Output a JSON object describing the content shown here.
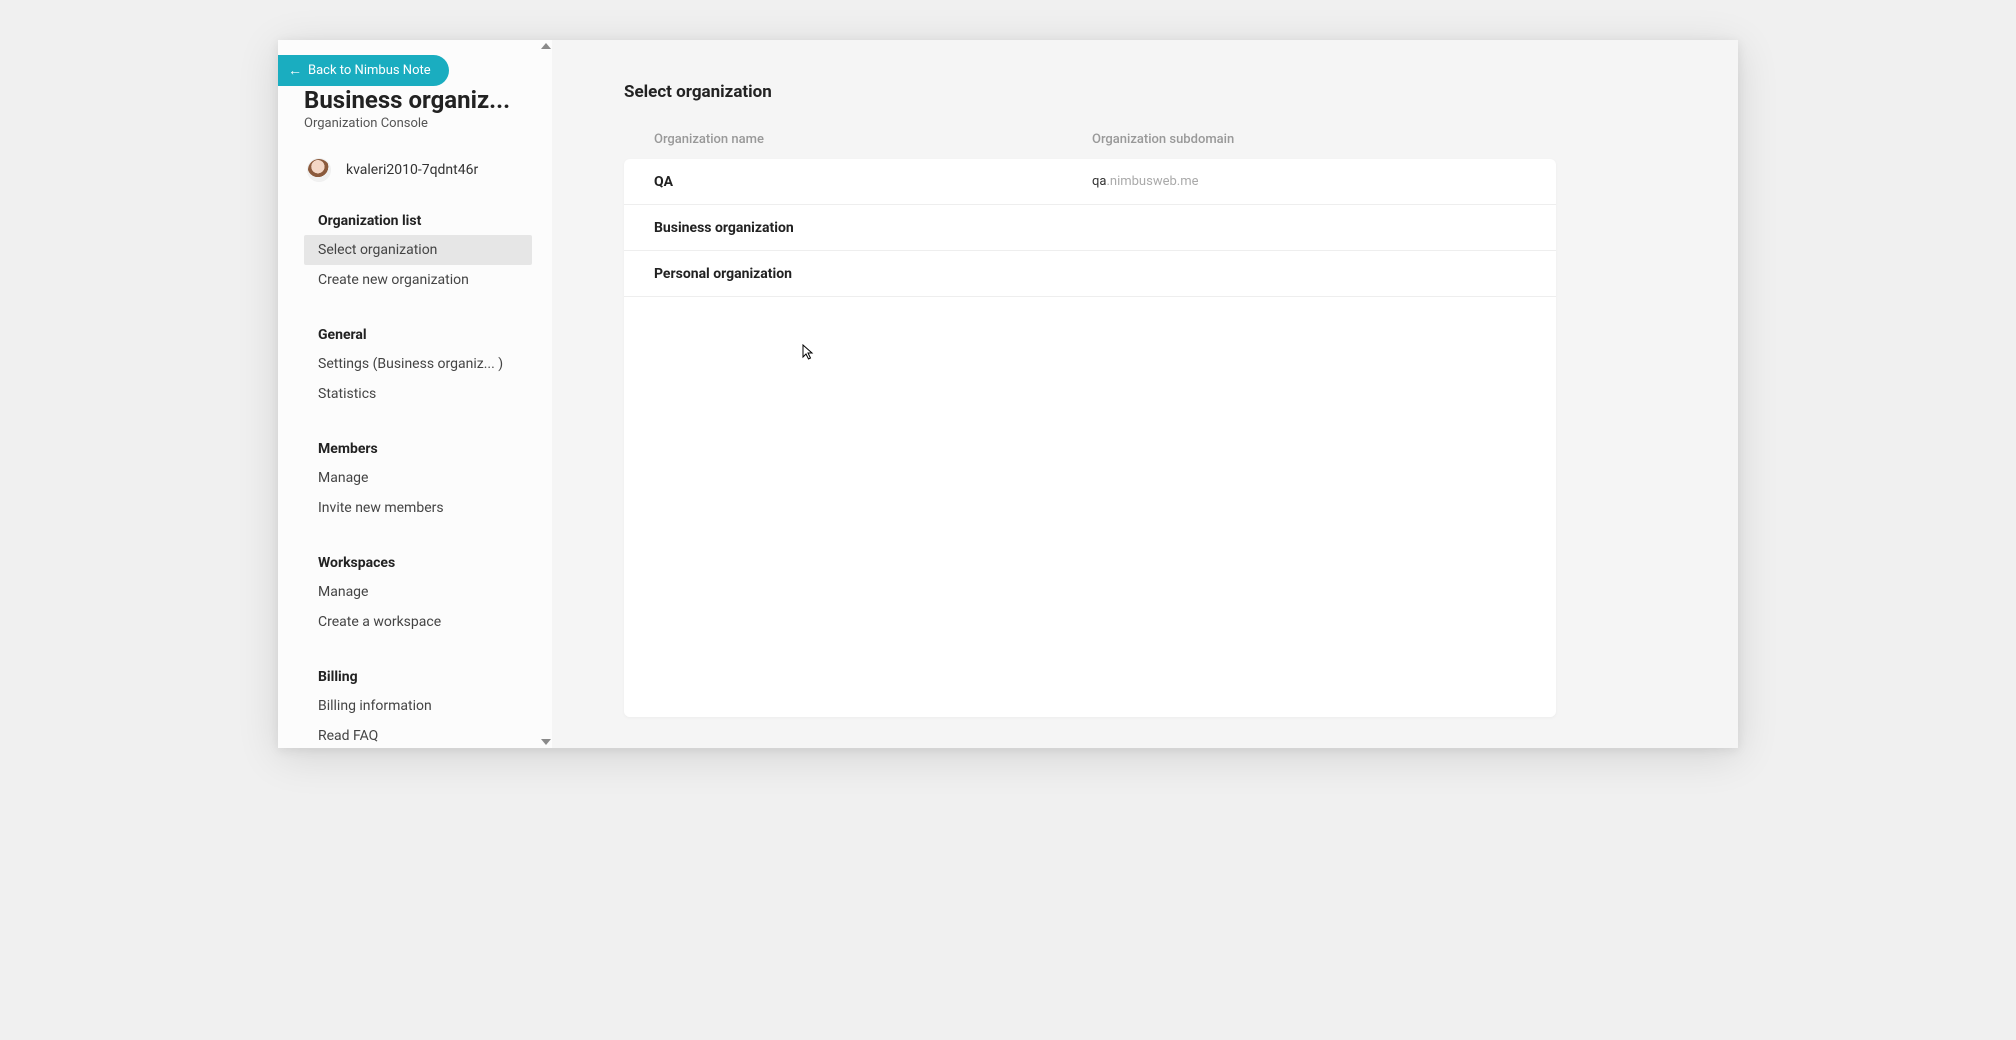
{
  "back_button": {
    "label": "Back to Nimbus Note"
  },
  "sidebar": {
    "org_title": "Business organiz...",
    "org_subtitle": "Organization Console",
    "user_name": "kvaleri2010-7qdnt46r",
    "sections": {
      "org_list": {
        "title": "Organization list",
        "items": {
          "select": "Select organization",
          "create": "Create new organization"
        }
      },
      "general": {
        "title": "General",
        "items": {
          "settings": "Settings (Business organiz... )",
          "statistics": "Statistics"
        }
      },
      "members": {
        "title": "Members",
        "items": {
          "manage": "Manage",
          "invite": "Invite new members"
        }
      },
      "workspaces": {
        "title": "Workspaces",
        "items": {
          "manage": "Manage",
          "create": "Create a workspace"
        }
      },
      "billing": {
        "title": "Billing",
        "items": {
          "info": "Billing information",
          "faq": "Read FAQ"
        }
      }
    }
  },
  "main": {
    "title": "Select organization",
    "columns": {
      "name": "Organization name",
      "subdomain": "Organization subdomain"
    },
    "rows": [
      {
        "name": "QA",
        "subdomain_strong": "qa",
        "subdomain_rest": ".nimbusweb.me"
      },
      {
        "name": "Business organization",
        "subdomain_strong": "",
        "subdomain_rest": ""
      },
      {
        "name": "Personal organization",
        "subdomain_strong": "",
        "subdomain_rest": ""
      }
    ]
  }
}
